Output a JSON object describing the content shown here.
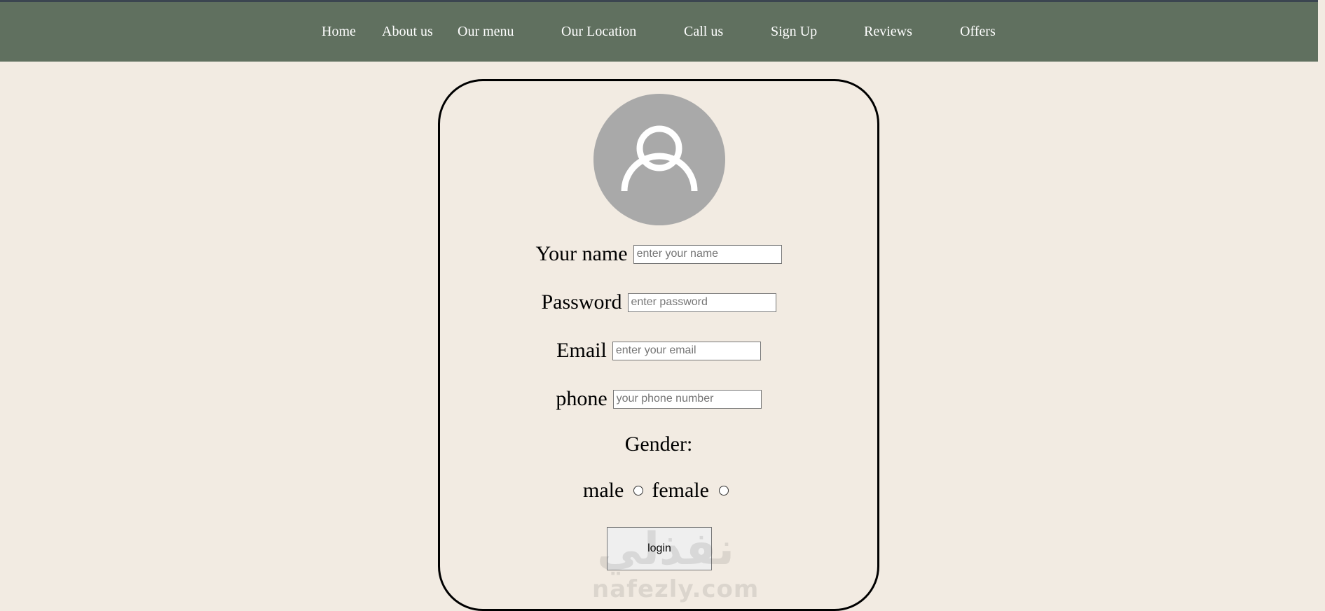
{
  "nav": {
    "items": [
      "Home",
      "About us",
      "Our menu",
      "Our Location",
      "Call us",
      "Sign Up",
      "Reviews",
      "Offers"
    ]
  },
  "avatar": {
    "icon": "user-icon"
  },
  "form": {
    "name_label": "Your name",
    "name_placeholder": "enter your name",
    "password_label": "Password",
    "password_placeholder": "enter password",
    "email_label": "Email",
    "email_placeholder": "enter your email",
    "phone_label": "phone",
    "phone_placeholder": "your phone number",
    "gender_label": "Gender:",
    "male_label": "male",
    "female_label": "female",
    "login_label": "login"
  },
  "watermark": {
    "arabic": "نفذلي",
    "latin": "nafezly.com"
  },
  "colors": {
    "nav_bg": "#60705f",
    "page_bg": "#f2ebe2",
    "avatar_bg": "#a9a9a9"
  }
}
